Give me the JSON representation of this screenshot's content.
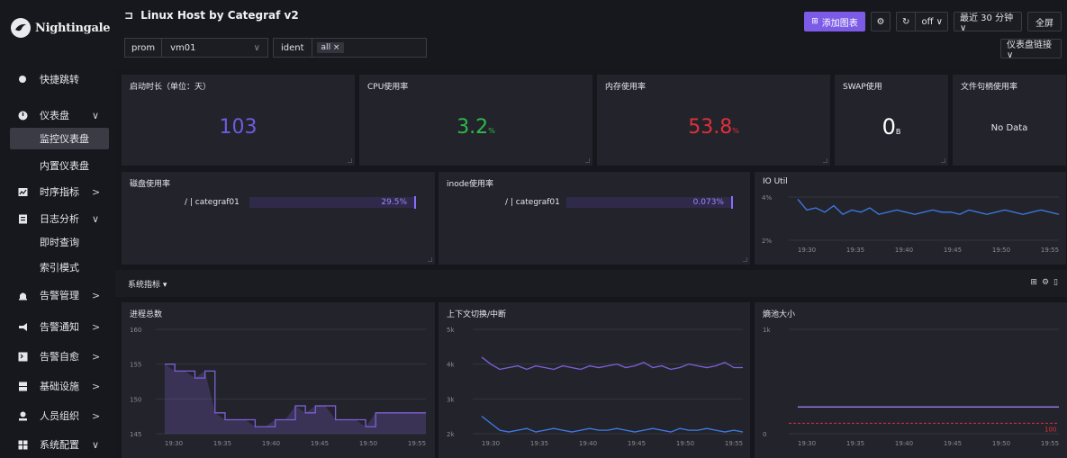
{
  "sidebar": {
    "logo": "Nightingale",
    "items": [
      {
        "label": "快捷跳转",
        "icon": "search-icon"
      },
      {
        "label": "仪表盘",
        "icon": "dashboard-icon",
        "arrow": "∨"
      },
      {
        "label": "时序指标",
        "icon": "chart-icon",
        "arrow": ">"
      },
      {
        "label": "日志分析",
        "icon": "log-icon",
        "arrow": "∨"
      },
      {
        "label": "告警管理",
        "icon": "alarm-icon",
        "arrow": ">"
      },
      {
        "label": "告警通知",
        "icon": "notify-icon",
        "arrow": ">"
      },
      {
        "label": "告警自愈",
        "icon": "terminal-icon",
        "arrow": ">"
      },
      {
        "label": "基础设施",
        "icon": "server-icon",
        "arrow": ">"
      },
      {
        "label": "人员组织",
        "icon": "user-icon",
        "arrow": ">"
      },
      {
        "label": "系统配置",
        "icon": "settings-grid-icon",
        "arrow": "∨"
      }
    ],
    "subitems": {
      "dashboards": [
        "监控仪表盘",
        "内置仪表盘"
      ],
      "logs": [
        "即时查询",
        "索引模式"
      ]
    }
  },
  "header": {
    "title": "Linux Host by Categraf v2",
    "filters": {
      "datasource_label": "prom",
      "datasource_value": "vm01",
      "ident_label": "ident",
      "ident_tag": "all ×"
    },
    "add_chart": "添加图表",
    "refresh_off": "off ∨",
    "time_range": "最近 30 分钟 ∨",
    "fullscreen": "全屏",
    "dashboard_links": "仪表盘链接 ∨"
  },
  "stats": [
    {
      "title": "启动时长（单位：天）",
      "value": "103",
      "unit": "",
      "color": "#6a5ce0"
    },
    {
      "title": "CPU使用率",
      "value": "3.2",
      "unit": "%",
      "color": "#2fb84a"
    },
    {
      "title": "内存使用率",
      "value": "53.8",
      "unit": "%",
      "color": "#e02f3b"
    },
    {
      "title": "SWAP使用",
      "value": "0",
      "unit": "B",
      "color": "#ffffff"
    },
    {
      "title": "文件句柄使用率",
      "value": "No Data",
      "unit": "",
      "color": "#e6e6ea"
    }
  ],
  "gauges": [
    {
      "title": "磁盘使用率",
      "label": "/ | categraf01",
      "value_text": "29.5%",
      "value": 0.295
    },
    {
      "title": "inode使用率",
      "label": "/ | categraf01",
      "value_text": "0.073%",
      "value": 0.00073
    }
  ],
  "group": {
    "title": "系统指标 ▾",
    "icons": [
      "add-icon",
      "gear-icon",
      "delete-icon"
    ]
  },
  "chart_data": [
    {
      "type": "line",
      "title": "IO Util",
      "x": [
        "19:30",
        "19:35",
        "19:40",
        "19:45",
        "19:50",
        "19:55"
      ],
      "y_ticks": [
        "4%",
        "2%"
      ],
      "ylim": [
        2,
        4
      ],
      "series": [
        {
          "color": "#3d7be8",
          "values": [
            3.9,
            3.4,
            3.5,
            3.3,
            3.6,
            3.2,
            3.4,
            3.3,
            3.5,
            3.2,
            3.3,
            3.4,
            3.3,
            3.2,
            3.3,
            3.4,
            3.3,
            3.3,
            3.2,
            3.4,
            3.3,
            3.2,
            3.3,
            3.4,
            3.3,
            3.2,
            3.3,
            3.4,
            3.3,
            3.2
          ]
        }
      ]
    },
    {
      "type": "line",
      "title": "进程总数",
      "x": [
        "19:30",
        "19:35",
        "19:40",
        "19:45",
        "19:50",
        "19:55"
      ],
      "y_ticks": [
        "160",
        "155",
        "150",
        "145"
      ],
      "ylim": [
        145,
        160
      ],
      "series": [
        {
          "color": "#7f5fd6",
          "fill": true,
          "values": [
            155,
            154,
            154,
            153,
            154,
            148,
            147,
            147,
            147,
            146,
            146,
            147,
            147,
            149,
            148,
            149,
            149,
            147,
            147,
            147,
            146,
            148,
            148,
            148,
            148,
            148,
            148
          ]
        }
      ]
    },
    {
      "type": "line",
      "title": "上下文切换/中断",
      "x": [
        "19:30",
        "19:35",
        "19:40",
        "19:45",
        "19:50",
        "19:55"
      ],
      "y_ticks": [
        "5k",
        "4k",
        "3k",
        "2k"
      ],
      "ylim": [
        2000,
        5000
      ],
      "series": [
        {
          "color": "#7f5fd6",
          "values": [
            4200,
            4000,
            3850,
            3900,
            3950,
            3850,
            3950,
            3900,
            3850,
            3950,
            3900,
            3850,
            3950,
            3900,
            3950,
            4000,
            3900,
            3950,
            4050,
            3900,
            3950,
            3850,
            3900,
            4000,
            3950,
            3900,
            3950,
            4050,
            3900,
            3900
          ]
        },
        {
          "color": "#3d7be8",
          "values": [
            2500,
            2300,
            2100,
            2050,
            2100,
            2150,
            2050,
            2100,
            2150,
            2100,
            2050,
            2100,
            2150,
            2100,
            2100,
            2150,
            2100,
            2050,
            2100,
            2150,
            2100,
            2050,
            2150,
            2100,
            2100,
            2150,
            2100,
            2050,
            2100,
            2050
          ]
        }
      ]
    },
    {
      "type": "line",
      "title": "熵池大小",
      "x": [
        "19:30",
        "19:35",
        "19:40",
        "19:45",
        "19:50",
        "19:55"
      ],
      "y_ticks": [
        "1k",
        "0"
      ],
      "ylim": [
        0,
        1000
      ],
      "threshold": {
        "value": 100,
        "label": "100",
        "color": "#e02f3b"
      },
      "series": [
        {
          "color": "#9d7bf0",
          "values": [
            256,
            256,
            256,
            256,
            256,
            256
          ]
        }
      ]
    }
  ]
}
